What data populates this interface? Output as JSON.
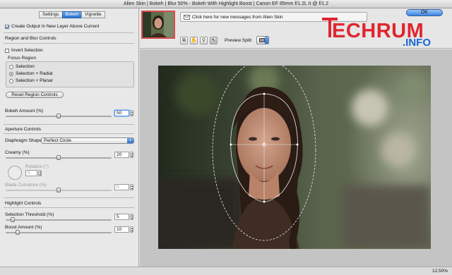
{
  "window": {
    "title": "Alien Skin | Bokeh | Blur 50% - Bokeh With Highlight Boost | Canon EF 85mm f/1.2L II @ f/1.2"
  },
  "tabs": [
    "Settings",
    "Bokeh",
    "Vignette"
  ],
  "active_tab": "Bokeh",
  "left_panel": {
    "create_output_label": "Create Output In New Layer Above Current",
    "create_output_checked": true,
    "region_section": "Region and Blur Controls",
    "invert_selection_label": "Invert Selection",
    "invert_selection_checked": false,
    "focus_region_label": "Focus Region",
    "focus_region_options": [
      "Selection",
      "Selection + Radial",
      "Selection + Planar"
    ],
    "focus_region_selected": "Selection + Radial",
    "reset_button": "Reset Region Controls",
    "bokeh_amount_label": "Bokeh Amount (%)",
    "bokeh_amount_value": "50",
    "aperture_section": "Aperture Controls",
    "diaphragm_label": "Diaphragm Shape",
    "diaphragm_value": "Perfect Circle",
    "creamy_label": "Creamy (%)",
    "creamy_value": "20",
    "rotation_label": "Rotation (°)",
    "rotation_value": "0",
    "blade_curvature_label": "Blade Curvature (%)",
    "blade_curvature_value": "0",
    "highlight_section": "Highlight Controls",
    "selection_threshold_label": "Selection Threshold (%)",
    "selection_threshold_value": "5",
    "boost_amount_label": "Boost Amount (%)",
    "boost_amount_value": "10"
  },
  "sliders": {
    "bokeh_amount": 0.5,
    "creamy": 0.5,
    "blade_curvature": 0.5,
    "selection_threshold": 0.05,
    "boost_amount": 0.1
  },
  "top_strip": {
    "message": "Click here for new messages from Alien Skin",
    "preview_split_label": "Preview Split:",
    "ok_button": "OK"
  },
  "watermark": {
    "text_main": "TECHRUM",
    "text_sub": ".INFO"
  },
  "icons": {
    "tools": [
      "compare-icon",
      "hand-icon",
      "zoom-icon",
      "pointer-icon"
    ],
    "message": "envelope-icon",
    "preview_split": "split-view-icon"
  },
  "colors": {
    "accent": "#3d85e0",
    "logo_red": "#e0262f",
    "logo_blue": "#1a67d6"
  },
  "status": {
    "zoom": "12.50%"
  }
}
